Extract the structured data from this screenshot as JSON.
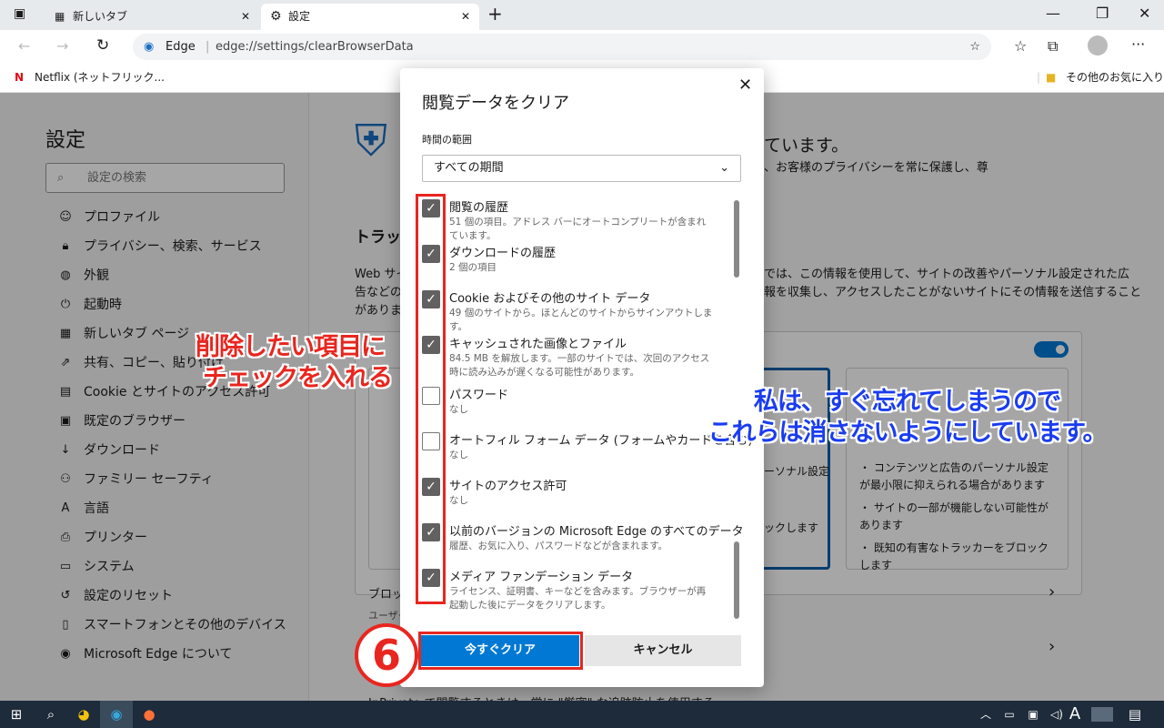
{
  "tabs": [
    {
      "label": "新しいタブ",
      "active": false
    },
    {
      "label": "設定",
      "active": true
    }
  ],
  "address": {
    "site_label": "Edge",
    "url": "edge://settings/clearBrowserData"
  },
  "favorites": {
    "left": "Netflix (ネットフリック...",
    "right": "その他のお気に入り"
  },
  "sidebar": {
    "title": "設定",
    "search_placeholder": "設定の検索",
    "items": [
      {
        "label": "プロファイル",
        "icon": "profile-icon"
      },
      {
        "label": "プライバシー、検索、サービス",
        "icon": "lock-icon"
      },
      {
        "label": "外観",
        "icon": "palette-icon"
      },
      {
        "label": "起動時",
        "icon": "power-icon"
      },
      {
        "label": "新しいタブ ページ",
        "icon": "newtab-icon"
      },
      {
        "label": "共有、コピー、貼り付け",
        "icon": "share-icon"
      },
      {
        "label": "Cookie とサイトのアクセス許可",
        "icon": "cookie-icon"
      },
      {
        "label": "既定のブラウザー",
        "icon": "browser-icon"
      },
      {
        "label": "ダウンロード",
        "icon": "download-icon"
      },
      {
        "label": "ファミリー セーフティ",
        "icon": "family-icon"
      },
      {
        "label": "言語",
        "icon": "language-icon"
      },
      {
        "label": "プリンター",
        "icon": "printer-icon"
      },
      {
        "label": "システム",
        "icon": "system-icon"
      },
      {
        "label": "設定のリセット",
        "icon": "reset-icon"
      },
      {
        "label": "スマートフォンとその他のデバイス",
        "icon": "phone-icon"
      },
      {
        "label": "Microsoft Edge について",
        "icon": "edge-icon"
      }
    ]
  },
  "background": {
    "heading_fragment": "ています。",
    "sub_fragment": "、お客様のプライバシーを常に保護し、尊",
    "tracking_fragment": "トラッキ",
    "para_left": [
      "Web サイ",
      "告などの",
      "がありま"
    ],
    "para_right": [
      "では、この情報を使用して、サイトの改善やパーソナル設定された広",
      "報を収集し、アクセスしたことがないサイトにその情報を送信すること"
    ],
    "mid_card": [
      "ーソナル設定",
      "ックします"
    ],
    "right_card": [
      "コンテンツと広告のパーソナル設定が最小限に抑えられる場合があります",
      "サイトの一部が機能しない可能性があります",
      "既知の有害なトラッカーをブロックします"
    ],
    "block_title": "ブロッ",
    "block_sub": "ユーザー",
    "inprivate": "InPrivate で閲覧するときは、常に \"厳密\" な追跡防止を使用する"
  },
  "dialog": {
    "title": "閲覧データをクリア",
    "range_label": "時間の範囲",
    "range_value": "すべての期間",
    "items": [
      {
        "title": "閲覧の履歴",
        "desc": "51 個の項目。アドレス バーにオートコンプリートが含まれています。",
        "checked": true
      },
      {
        "title": "ダウンロードの履歴",
        "desc": "2 個の項目",
        "checked": true
      },
      {
        "title": "Cookie およびその他のサイト データ",
        "desc": "49 個のサイトから。ほとんどのサイトからサインアウトします。",
        "checked": true
      },
      {
        "title": "キャッシュされた画像とファイル",
        "desc": "84.5 MB を解放します。一部のサイトでは、次回のアクセス時に読み込みが遅くなる可能性があります。",
        "checked": true
      },
      {
        "title": "パスワード",
        "desc": "なし",
        "checked": false
      },
      {
        "title": "オートフィル フォーム データ (フォームやカードを含む)",
        "desc": "なし",
        "checked": false
      },
      {
        "title": "サイトのアクセス許可",
        "desc": "なし",
        "checked": true
      },
      {
        "title": "以前のバージョンの Microsoft Edge のすべてのデータ",
        "desc": "履歴、お気に入り、パスワードなどが含まれます。",
        "checked": true
      },
      {
        "title": "メディア ファンデーション データ",
        "desc": "ライセンス、証明書、キーなどを含みます。ブラウザーが再起動した後にデータをクリアします。",
        "checked": true
      }
    ],
    "clear_label": "今すぐクリア",
    "cancel_label": "キャンセル"
  },
  "annotations": {
    "red": [
      "削除したい項目に",
      "チェックを入れる"
    ],
    "blue": [
      "私は、すぐ忘れてしまうので",
      "これらは消さないようにしています。"
    ],
    "step": "6"
  },
  "taskbar": {
    "ime": "A"
  },
  "colors": {
    "accent": "#0078d4",
    "annotation_red": "#e8261f",
    "annotation_blue": "#1a3cf0"
  }
}
